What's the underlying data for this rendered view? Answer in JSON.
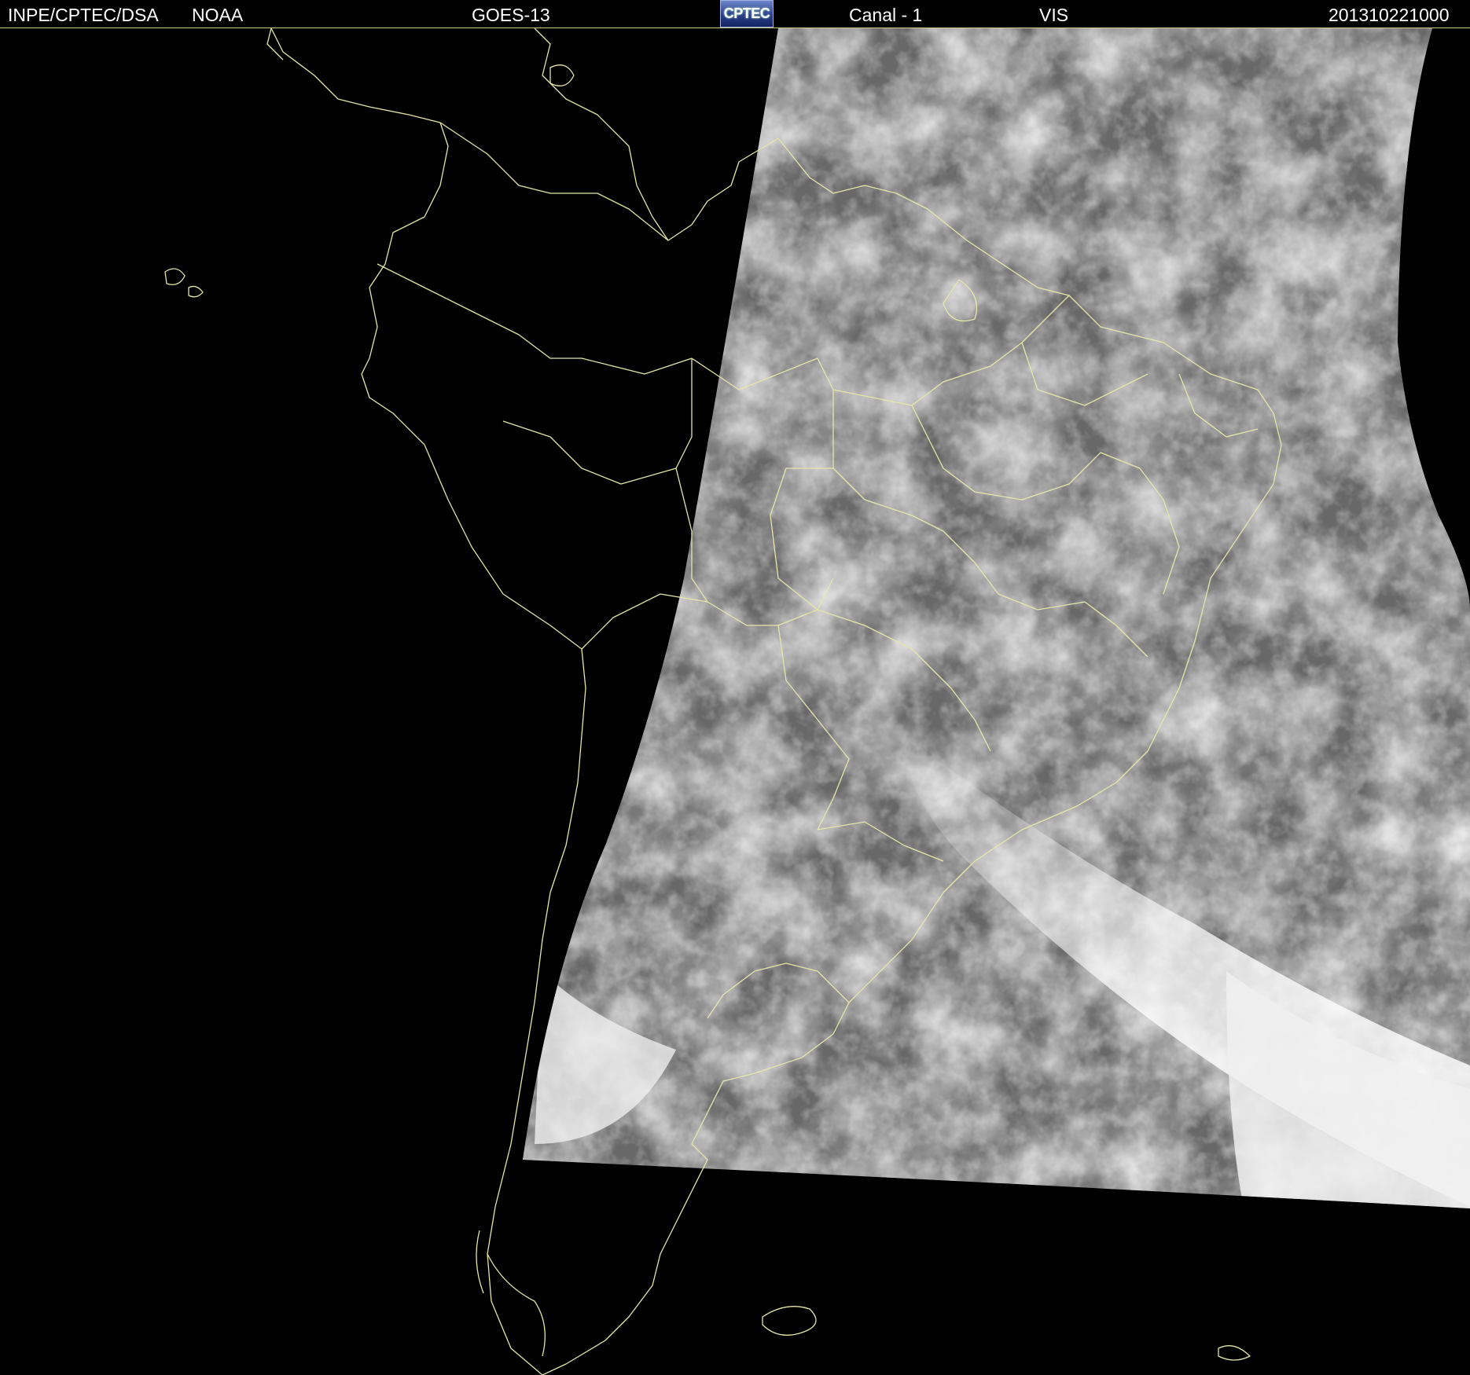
{
  "header": {
    "institution": "INPE/CPTEC/DSA",
    "agency": "NOAA",
    "satellite": "GOES-13",
    "logo_text": "CPTEC",
    "channel": "Canal - 1",
    "band": "VIS",
    "timestamp": "201310221000"
  },
  "map": {
    "type": "visible satellite image",
    "colors": {
      "background": "#000000",
      "coastline": "#e6e6a8",
      "cloud_bright": "#f2f2f2",
      "surface_gray": "#6a6a6a"
    }
  }
}
